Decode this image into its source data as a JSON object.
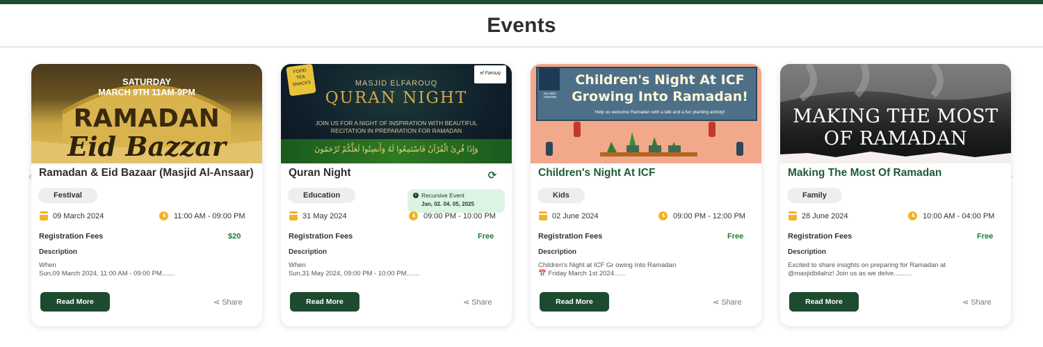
{
  "page": {
    "title": "Events"
  },
  "nav": {
    "prev": "‹",
    "next": "›"
  },
  "share_label": "Share",
  "read_more_label": "Read More",
  "fees_label": "Registration Fees",
  "description_label": "Description",
  "colors": {
    "brand": "#1d4b30",
    "accent": "#f5b322",
    "fee": "#1e7a3c"
  },
  "events": [
    {
      "banner": {
        "line1": "SATURDAY",
        "line2": "MARCH 9TH  11AM-9PM",
        "line3": "RAMADAN",
        "line4": "Eid Bazzar"
      },
      "title": "Ramadan & Eid Bazaar (Masjid Al-Ansaar)",
      "category": "Festival",
      "date": "09 March 2024",
      "time": "11:00 AM - 09:00 PM",
      "fee": "$20",
      "description": [
        "When",
        "Sun,09 March 2024, 11:00 AM - 09:00 PM......."
      ]
    },
    {
      "banner": {
        "corner_left": "FOOD\nTEA\nSNACKS",
        "corner_right": "el Farouq",
        "line1": "MASJID ELFAROUQ",
        "line2": "QURAN NIGHT",
        "line3": "JOIN US FOR A NIGHT OF INSPIRATION WITH BEAUTIFUL",
        "line4": "RECITATION IN PREPARATION FOR RAMADAN",
        "arabic": "وَإِذَا قُرِئَ الْقُرْآنُ فَاسْتَمِعُوا لَهُ وَأَنصِتُوا لَعَلَّكُمْ تُرْحَمُونَ"
      },
      "title": "Quran Night",
      "category": "Education",
      "recursive": {
        "label": "Recursive Event",
        "dates": "Jan, 02. 04. 05, 2025"
      },
      "date": "31 May 2024",
      "time": "09:00 PM - 10:00 PM",
      "fee": "Free",
      "description": [
        "When",
        "Sun,31 May 2024, 09:00 PM - 10:00 PM......."
      ]
    },
    {
      "banner": {
        "logo": "ISLAMIC CENTER",
        "line1": "Children's Night At ICF",
        "line2": "Growing Into Ramadan!",
        "line3": "Help us welcome Ramadan with a talk and a fun planting activity!"
      },
      "title": "Children's Night At ICF",
      "category": "Kids",
      "date": "02 June 2024",
      "time": "09:00 PM - 12:00 PM",
      "fee": "Free",
      "description": [
        "Children's Night at ICF Gr owing Into Ramadan",
        "📅 Friday March 1st 2024......"
      ]
    },
    {
      "banner": {
        "line1": "MAKING THE MOST",
        "line2": "OF RAMADAN"
      },
      "title": "Making The Most Of Ramadan",
      "category": "Family",
      "date": "28 June 2024",
      "time": "10:00 AM - 04:00 PM",
      "fee": "Free",
      "description": [
        "Excited to share insights on preparing for Ramadan at",
        "@masjidbilalnz! Join us as we delve.........."
      ]
    }
  ]
}
